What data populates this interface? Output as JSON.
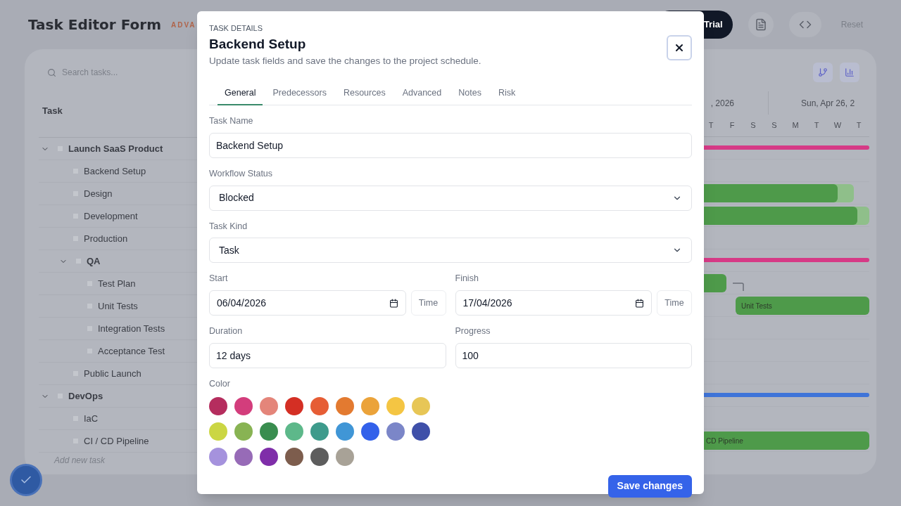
{
  "page": {
    "title": "Task Editor Form",
    "badge": "ADVA",
    "trial_button": "Trial",
    "reset_button": "Reset"
  },
  "task_list": {
    "search_placeholder": "Search tasks...",
    "column": "Task",
    "add_task": "Add new task",
    "tree": [
      {
        "name": "Launch SaaS Product",
        "expanded": true,
        "bar": {
          "kind": "summary",
          "color": "#d63a86"
        },
        "children": [
          {
            "name": "Backend Setup"
          },
          {
            "name": "Design",
            "bar": {
              "kind": "task",
              "color": "#4e9a4a"
            }
          },
          {
            "name": "Development",
            "bar": {
              "kind": "task",
              "color": "#4e9a4a"
            }
          },
          {
            "name": "Production"
          },
          {
            "name": "QA",
            "expanded": true,
            "bar": {
              "kind": "summary",
              "color": "#d63a86"
            },
            "children": [
              {
                "name": "Test Plan",
                "bar": {
                  "kind": "task",
                  "color": "#4e9a4a"
                }
              },
              {
                "name": "Unit Tests",
                "bar": {
                  "kind": "task",
                  "color": "#4e9a4a",
                  "label": "Unit Tests"
                }
              },
              {
                "name": "Integration Tests"
              },
              {
                "name": "Acceptance Test"
              }
            ]
          },
          {
            "name": "Public Launch"
          }
        ]
      },
      {
        "name": "DevOps",
        "expanded": true,
        "bar": {
          "kind": "summary",
          "color": "#3f74d8"
        },
        "children": [
          {
            "name": "IaC"
          },
          {
            "name": "CI / CD Pipeline",
            "bar": {
              "kind": "task",
              "color": "#4e9a4a",
              "label": "CD Pipeline"
            }
          }
        ]
      }
    ]
  },
  "gantt": {
    "weeks": [
      ", 2026",
      "Sun, Apr 26, 2"
    ],
    "days": [
      "T",
      "F",
      "S",
      "S",
      "M",
      "T",
      "W",
      "T"
    ]
  },
  "dialog": {
    "eyebrow": "TASK DETAILS",
    "title": "Backend Setup",
    "description": "Update task fields and save the changes to the project schedule.",
    "tabs": [
      {
        "label": "General",
        "selected": true
      },
      {
        "label": "Predecessors",
        "selected": false
      },
      {
        "label": "Resources",
        "selected": false
      },
      {
        "label": "Advanced",
        "selected": false
      },
      {
        "label": "Notes",
        "selected": false
      },
      {
        "label": "Risk",
        "selected": false
      }
    ],
    "task_name": {
      "label": "Task Name",
      "value": "Backend Setup"
    },
    "workflow_status": {
      "label": "Workflow Status",
      "value": "Blocked"
    },
    "task_kind": {
      "label": "Task Kind",
      "value": "Task"
    },
    "start": {
      "label": "Start",
      "value": "06/04/2026",
      "time_button": "Time"
    },
    "finish": {
      "label": "Finish",
      "value": "17/04/2026",
      "time_button": "Time"
    },
    "duration": {
      "label": "Duration",
      "value": "12 days"
    },
    "progress": {
      "label": "Progress",
      "value": "100"
    },
    "color": {
      "label": "Color",
      "swatches": [
        {
          "color": "#b52d5e"
        },
        {
          "color": "#d33d7c"
        },
        {
          "color": "#e4857a"
        },
        {
          "color": "#d42f24"
        },
        {
          "color": "#e65d35"
        },
        {
          "color": "#e37a30"
        },
        {
          "color": "#eba33a"
        },
        {
          "color": "#f4c543"
        },
        {
          "color": "#e7c656"
        },
        {
          "color": "#cbd643"
        },
        {
          "color": "#88b353"
        },
        {
          "color": "#398d4f"
        },
        {
          "color": "#5db88a"
        },
        {
          "color": "#3e9b8c"
        },
        {
          "color": "#4096d6"
        },
        {
          "color": "#3361ea"
        },
        {
          "color": "#7b86c8"
        },
        {
          "color": "#3f50a9"
        },
        {
          "color": "#a592dd"
        },
        {
          "color": "#976bb7"
        },
        {
          "color": "#7f2ea9"
        },
        {
          "color": "#7d5d4d"
        },
        {
          "color": "#5d5d5d"
        },
        {
          "color": "#a8a297"
        }
      ]
    },
    "save_button": "Save changes"
  }
}
